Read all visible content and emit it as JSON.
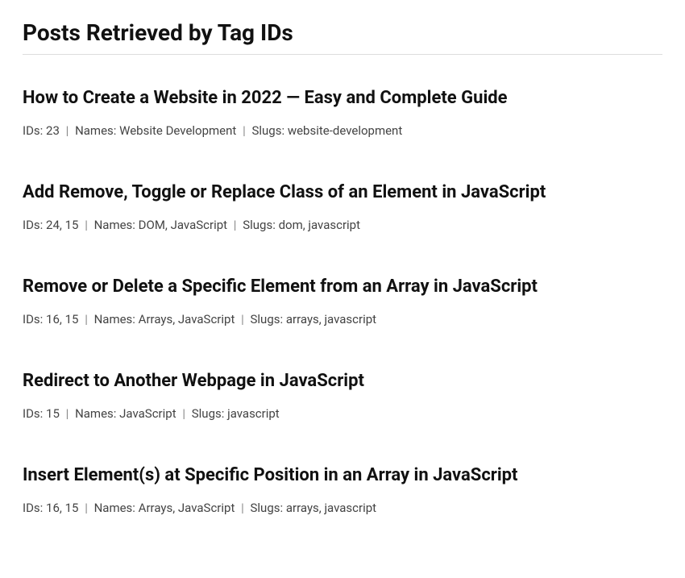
{
  "page_title": "Posts Retrieved by Tag IDs",
  "labels": {
    "ids": "IDs:",
    "names": "Names:",
    "slugs": "Slugs:"
  },
  "posts": [
    {
      "title": "How to Create a Website in 2022 — Easy and Complete Guide",
      "ids": "23",
      "names": "Website Development",
      "slugs": "website-development"
    },
    {
      "title": "Add Remove, Toggle or Replace Class of an Element in JavaScript",
      "ids": "24, 15",
      "names": "DOM, JavaScript",
      "slugs": "dom, javascript"
    },
    {
      "title": "Remove or Delete a Specific Element from an Array in JavaScript",
      "ids": "16, 15",
      "names": "Arrays, JavaScript",
      "slugs": "arrays, javascript"
    },
    {
      "title": "Redirect to Another Webpage in JavaScript",
      "ids": "15",
      "names": "JavaScript",
      "slugs": "javascript"
    },
    {
      "title": "Insert Element(s) at Specific Position in an Array in JavaScript",
      "ids": "16, 15",
      "names": "Arrays, JavaScript",
      "slugs": "arrays, javascript"
    }
  ]
}
